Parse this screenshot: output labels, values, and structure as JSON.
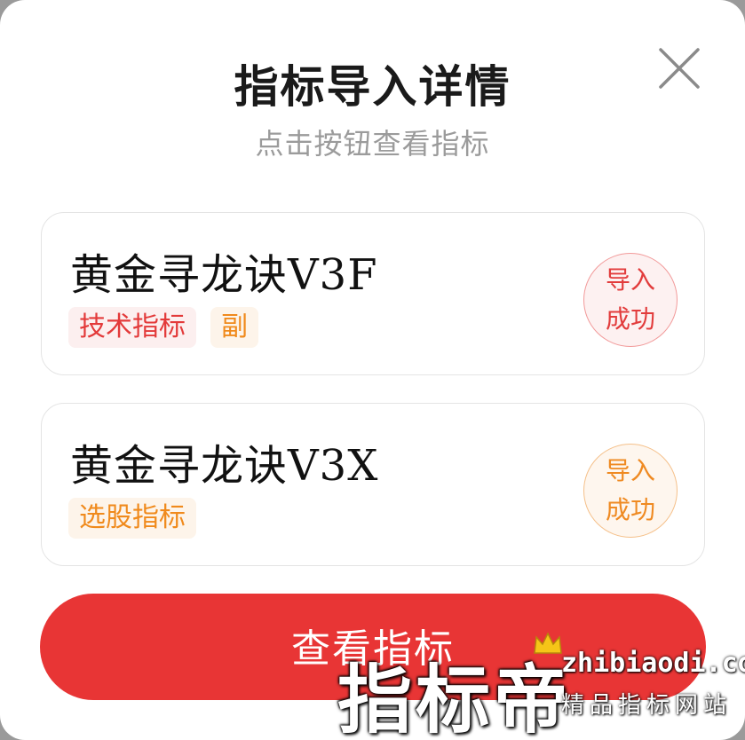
{
  "dialog": {
    "title": "指标导入详情",
    "subtitle": "点击按钮查看指标",
    "close_icon": "close-icon"
  },
  "indicators": [
    {
      "name": "黄金寻龙诀V3F",
      "tags": [
        "技术指标",
        "副"
      ],
      "status_line1": "导入",
      "status_line2": "成功",
      "status_color": "#e23c3c"
    },
    {
      "name": "黄金寻龙诀V3X",
      "tags": [
        "选股指标"
      ],
      "status_line1": "导入",
      "status_line2": "成功",
      "status_color": "#ef8a22"
    }
  ],
  "action": {
    "view_button_label": "查看指标",
    "button_color": "#e83535"
  },
  "watermark": {
    "brand": "指标帝",
    "site": "zhibiaodi.com",
    "slogan": "精品指标网站"
  }
}
